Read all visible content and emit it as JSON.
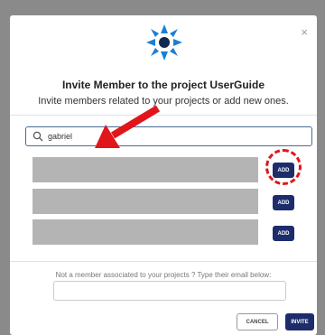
{
  "modal": {
    "title": "Invite Member to the project UserGuide",
    "subtitle": "Invite members related to your projects or add new ones.",
    "close_label": "×"
  },
  "search": {
    "value": "gabriel",
    "icon": "search-icon"
  },
  "results": [
    {
      "add_label": "ADD"
    },
    {
      "add_label": "ADD"
    },
    {
      "add_label": "ADD"
    }
  ],
  "email": {
    "label": "Not a member associated to your projects ? Type their email below:",
    "value": ""
  },
  "footer": {
    "cancel_label": "CANCEL",
    "invite_label": "INVITE"
  },
  "colors": {
    "primary": "#1d2d6b",
    "logo": "#1c7fd6",
    "annotation": "#e0161b",
    "redacted": "#b4b4b4"
  }
}
